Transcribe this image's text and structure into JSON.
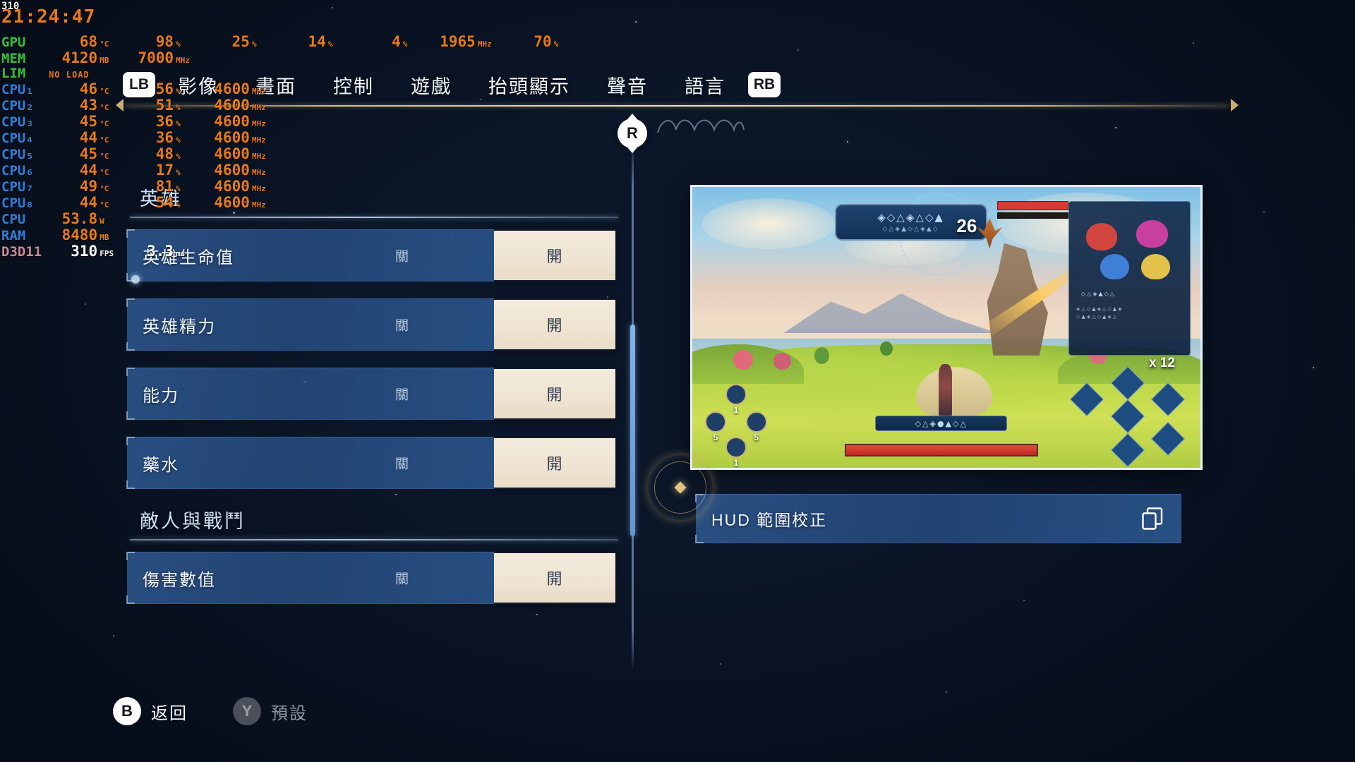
{
  "overlay": {
    "fps_corner": "310",
    "clock": "21:24:47",
    "rows": [
      {
        "label": "GPU",
        "color": "green",
        "cells": [
          {
            "value": "68",
            "unit": "°C"
          },
          {
            "value": "98",
            "unit": "%"
          },
          {
            "value": "25",
            "unit": "%"
          },
          {
            "value": "14",
            "unit": "%"
          },
          {
            "value": "4",
            "unit": "%"
          },
          {
            "value": "1965",
            "unit": "MHz"
          },
          {
            "value": "70",
            "unit": "%"
          }
        ]
      },
      {
        "label": "MEM",
        "color": "green",
        "cells": [
          {
            "value": "4120",
            "unit": "MB"
          },
          {
            "value": "7000",
            "unit": "MHz"
          }
        ]
      },
      {
        "label": "LIM",
        "color": "green",
        "noload": "NO LOAD",
        "cells": []
      },
      {
        "label": "CPU₁",
        "color": "blue",
        "cells": [
          {
            "value": "46",
            "unit": "°C"
          },
          {
            "value": "56",
            "unit": "%"
          },
          {
            "value": "4600",
            "unit": "MHz"
          }
        ]
      },
      {
        "label": "CPU₂",
        "color": "blue",
        "cells": [
          {
            "value": "43",
            "unit": "°C"
          },
          {
            "value": "51",
            "unit": "%"
          },
          {
            "value": "4600",
            "unit": "MHz"
          }
        ]
      },
      {
        "label": "CPU₃",
        "color": "blue",
        "cells": [
          {
            "value": "45",
            "unit": "°C"
          },
          {
            "value": "36",
            "unit": "%"
          },
          {
            "value": "4600",
            "unit": "MHz"
          }
        ]
      },
      {
        "label": "CPU₄",
        "color": "blue",
        "cells": [
          {
            "value": "44",
            "unit": "°C"
          },
          {
            "value": "36",
            "unit": "%"
          },
          {
            "value": "4600",
            "unit": "MHz"
          }
        ]
      },
      {
        "label": "CPU₅",
        "color": "blue",
        "cells": [
          {
            "value": "45",
            "unit": "°C"
          },
          {
            "value": "48",
            "unit": "%"
          },
          {
            "value": "4600",
            "unit": "MHz"
          }
        ]
      },
      {
        "label": "CPU₆",
        "color": "blue",
        "cells": [
          {
            "value": "44",
            "unit": "°C"
          },
          {
            "value": "17",
            "unit": "%"
          },
          {
            "value": "4600",
            "unit": "MHz"
          }
        ]
      },
      {
        "label": "CPU₇",
        "color": "blue",
        "cells": [
          {
            "value": "49",
            "unit": "°C"
          },
          {
            "value": "81",
            "unit": "%"
          },
          {
            "value": "4600",
            "unit": "MHz"
          }
        ]
      },
      {
        "label": "CPU₈",
        "color": "blue",
        "cells": [
          {
            "value": "44",
            "unit": "°C"
          },
          {
            "value": "54",
            "unit": "%"
          },
          {
            "value": "4600",
            "unit": "MHz"
          }
        ]
      },
      {
        "label": "CPU",
        "color": "blue",
        "cells": [
          {
            "value": "53.8",
            "unit": "W"
          }
        ]
      },
      {
        "label": "RAM",
        "color": "blue",
        "cells": [
          {
            "value": "8480",
            "unit": "MB"
          }
        ]
      },
      {
        "label": "D3D11",
        "color": "pink",
        "white": true,
        "cells": [
          {
            "value": "310",
            "unit": "FPS"
          },
          {
            "value": "3.3",
            "unit": "ms"
          }
        ]
      }
    ]
  },
  "nav": {
    "left_bumper": "LB",
    "right_bumper": "RB",
    "tabs": [
      {
        "label": "影像",
        "active": false
      },
      {
        "label": "畫面",
        "active": false
      },
      {
        "label": "控制",
        "active": false
      },
      {
        "label": "遊戲",
        "active": false
      },
      {
        "label": "抬頭顯示",
        "active": true
      },
      {
        "label": "聲音",
        "active": false
      },
      {
        "label": "語言",
        "active": false
      }
    ],
    "stick_glyph": "R"
  },
  "settings": {
    "sections": [
      {
        "title": "英雄",
        "rows": [
          {
            "label": "英雄生命值",
            "off_label": "關",
            "on_label": "開",
            "selected": "on"
          },
          {
            "label": "英雄精力",
            "off_label": "關",
            "on_label": "開",
            "selected": "on"
          },
          {
            "label": "能力",
            "off_label": "關",
            "on_label": "開",
            "selected": "on"
          },
          {
            "label": "藥水",
            "off_label": "關",
            "on_label": "開",
            "selected": "on"
          }
        ]
      },
      {
        "title": "敵人與戰鬥",
        "rows": [
          {
            "label": "傷害數值",
            "off_label": "關",
            "on_label": "開",
            "selected": "on"
          }
        ]
      }
    ]
  },
  "right_panel": {
    "hud_calibration_label": "HUD 範圍校正",
    "copy_icon": "copy-icon",
    "preview": {
      "damage_number": "26",
      "item_count": "x 12",
      "potion_counts": [
        "1",
        "5",
        "5",
        "1"
      ]
    }
  },
  "prompts": [
    {
      "glyph": "B",
      "label": "返回",
      "style": "on"
    },
    {
      "glyph": "Y",
      "label": "預設",
      "style": "off"
    }
  ],
  "colors": {
    "accent_gold": "#d8bd7e",
    "selected_cream": "#efe4d2",
    "row_blue": "#2c548a",
    "overlay_orange": "#e87b15",
    "overlay_green": "#35c03a",
    "overlay_blue": "#2f7fd8"
  }
}
